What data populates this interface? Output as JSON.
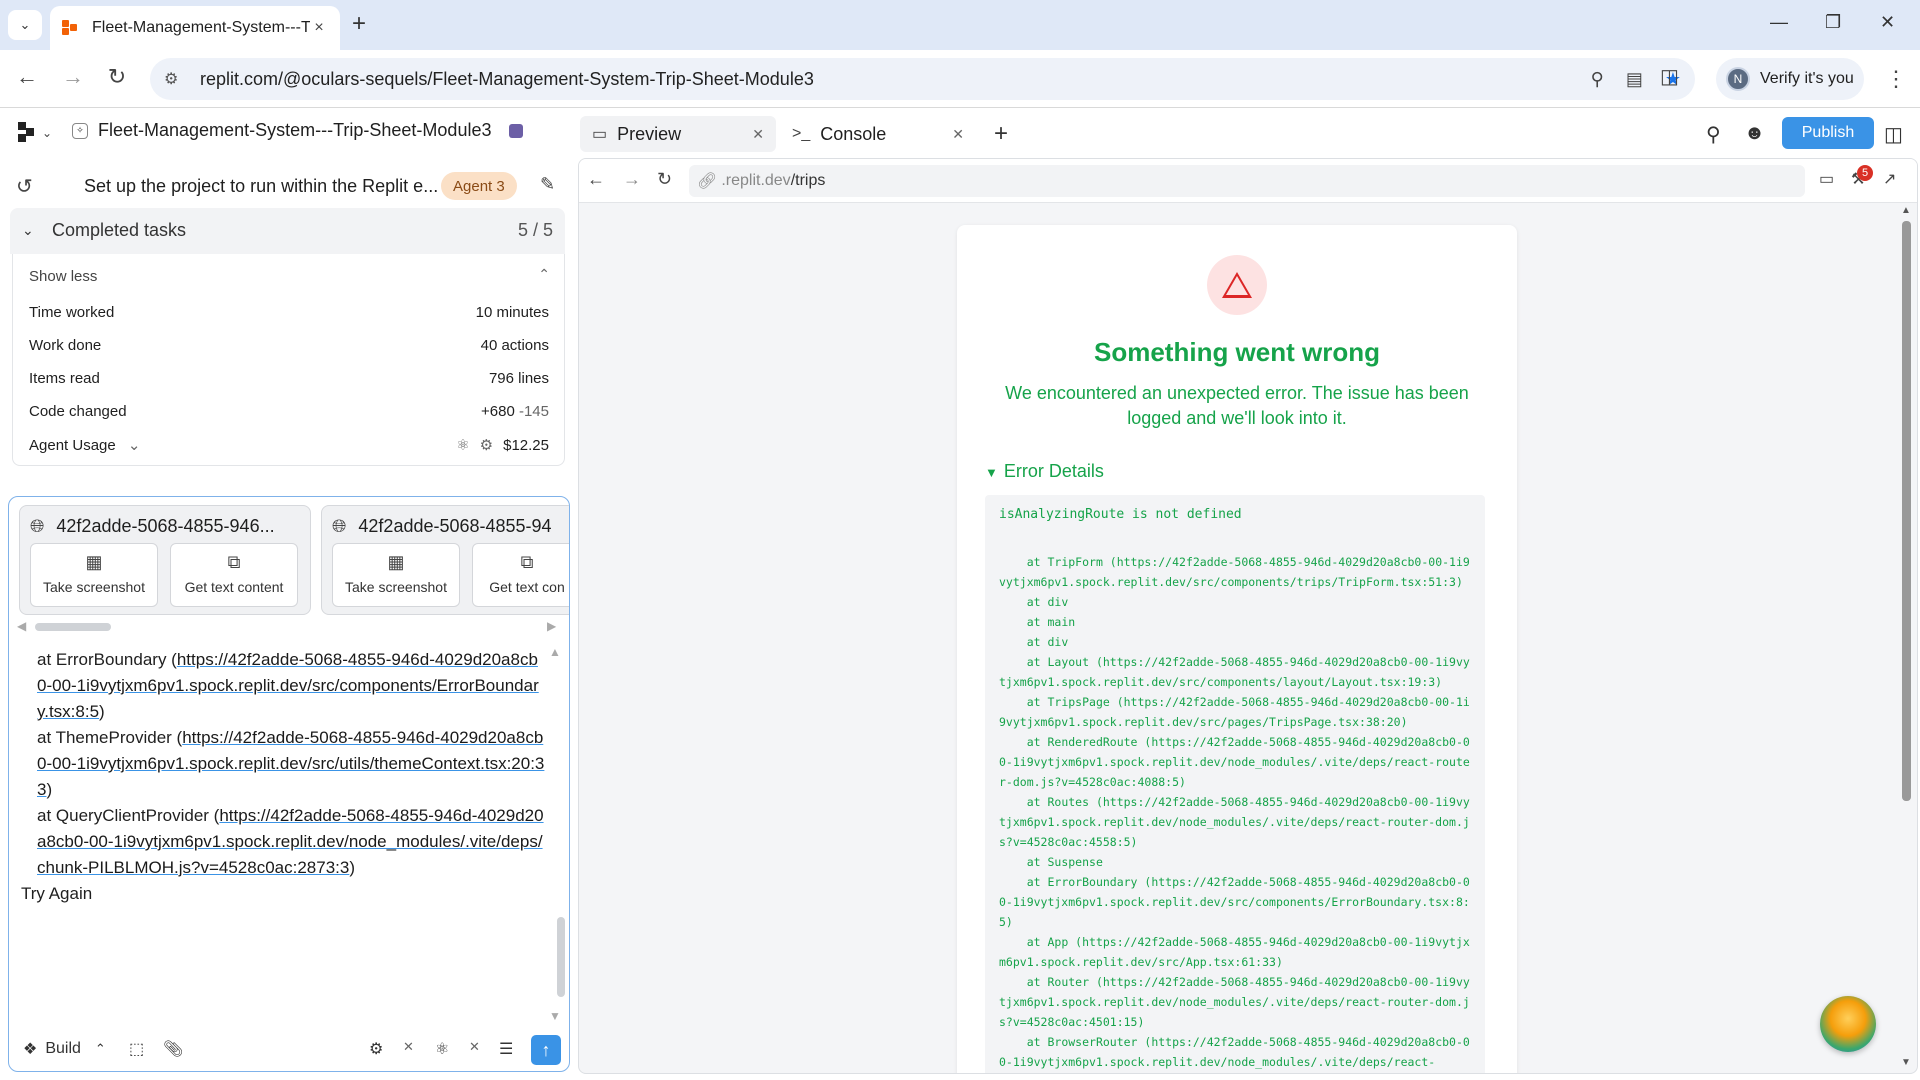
{
  "browser": {
    "tab_title": "Fleet-Management-System---Tr",
    "tab_close": "×",
    "new_tab": "+",
    "url": "replit.com/@oculars-sequels/Fleet-Management-System-Trip-Sheet-Module3",
    "profile_initial": "N",
    "verify_label": "Verify it's you"
  },
  "header": {
    "project_name": "Fleet-Management-System---Trip-Sheet-Module3",
    "tabs": [
      {
        "label": "Preview",
        "icon": "monitor-icon"
      },
      {
        "label": "Console",
        "icon": "terminal-icon"
      }
    ],
    "publish_label": "Publish"
  },
  "agent": {
    "task_title": "Set up the project to run within the Replit e...",
    "agent_badge": "Agent 3",
    "completed_label": "Completed tasks",
    "completed_count": "5 / 5",
    "show_less": "Show less",
    "stats": [
      {
        "label": "Time worked",
        "value": "10 minutes"
      },
      {
        "label": "Work done",
        "value": "40 actions"
      },
      {
        "label": "Items read",
        "value": "796 lines"
      }
    ],
    "code_changed_label": "Code changed",
    "code_added": "+680",
    "code_removed": "-145",
    "usage_label": "Agent Usage",
    "usage_value": "$12.25"
  },
  "tool_cards": [
    {
      "title": "42f2adde-5068-4855-946...",
      "btn1": "Take screenshot",
      "btn2": "Get text content"
    },
    {
      "title": "42f2adde-5068-4855-94",
      "btn1": "Take screenshot",
      "btn2": "Get text con"
    }
  ],
  "chat_error": {
    "l1_prefix": "at ErrorBoundary (",
    "l1_link": "https://42f2adde-5068-4855-946d-4029d20a8cb0-00-1i9vytjxm6pv1.spock.replit.dev/src/components/ErrorBoundary.tsx:8:5",
    "l1_suffix": ")",
    "l2_prefix": "at ThemeProvider (",
    "l2_link": "https://42f2adde-5068-4855-946d-4029d20a8cb0-00-1i9vytjxm6pv1.spock.replit.dev/src/utils/themeContext.tsx:20:33",
    "l2_suffix": ")",
    "l3_prefix": "at QueryClientProvider (",
    "l3_link": "https://42f2adde-5068-4855-946d-4029d20a8cb0-00-1i9vytjxm6pv1.spock.replit.dev/node_modules/.vite/deps/chunk-PILBLMOH.js?v=4528c0ac:2873:3",
    "l3_suffix": ")",
    "try_again": "Try Again"
  },
  "composer": {
    "mode_label": "Build"
  },
  "preview": {
    "url_prefix": ".replit.dev",
    "url_path": "/trips",
    "notification_count": "5",
    "error_title": "Something went wrong",
    "error_message": "We encountered an unexpected error. The issue has been logged and we'll look into it.",
    "details_label": "Error Details",
    "error_main": "isAnalyzingRoute is not defined",
    "stack": "    at TripForm (https://42f2adde-5068-4855-946d-4029d20a8cb0-00-1i9vytjxm6pv1.spock.replit.dev/src/components/trips/TripForm.tsx:51:3)\n    at div\n    at main\n    at div\n    at Layout (https://42f2adde-5068-4855-946d-4029d20a8cb0-00-1i9vytjxm6pv1.spock.replit.dev/src/components/layout/Layout.tsx:19:3)\n    at TripsPage (https://42f2adde-5068-4855-946d-4029d20a8cb0-00-1i9vytjxm6pv1.spock.replit.dev/src/pages/TripsPage.tsx:38:20)\n    at RenderedRoute (https://42f2adde-5068-4855-946d-4029d20a8cb0-00-1i9vytjxm6pv1.spock.replit.dev/node_modules/.vite/deps/react-router-dom.js?v=4528c0ac:4088:5)\n    at Routes (https://42f2adde-5068-4855-946d-4029d20a8cb0-00-1i9vytjxm6pv1.spock.replit.dev/node_modules/.vite/deps/react-router-dom.js?v=4528c0ac:4558:5)\n    at Suspense\n    at ErrorBoundary (https://42f2adde-5068-4855-946d-4029d20a8cb0-00-1i9vytjxm6pv1.spock.replit.dev/src/components/ErrorBoundary.tsx:8:5)\n    at App (https://42f2adde-5068-4855-946d-4029d20a8cb0-00-1i9vytjxm6pv1.spock.replit.dev/src/App.tsx:61:33)\n    at Router (https://42f2adde-5068-4855-946d-4029d20a8cb0-00-1i9vytjxm6pv1.spock.replit.dev/node_modules/.vite/deps/react-router-dom.js?v=4528c0ac:4501:15)\n    at BrowserRouter (https://42f2adde-5068-4855-946d-4029d20a8cb0-00-1i9vytjxm6pv1.spock.replit.dev/node_modules/.vite/deps/react-"
  }
}
